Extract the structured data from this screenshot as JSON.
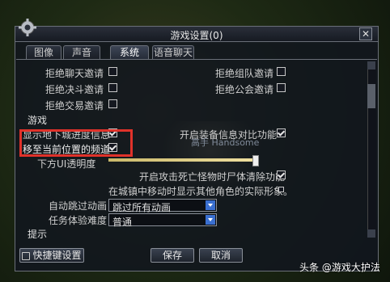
{
  "window": {
    "title": "游戏设置(0)"
  },
  "tabs": [
    {
      "label": "图像"
    },
    {
      "label": "声音"
    },
    {
      "label": "系统"
    },
    {
      "label": "语音聊天"
    }
  ],
  "privacy": {
    "chat_label": "拒绝聊天邀请",
    "party_label": "拒绝组队邀请",
    "duel_label": "拒绝决斗邀请",
    "guild_label": "拒绝公会邀请",
    "trade_label": "拒绝交易邀请"
  },
  "game": {
    "section_label": "游戏",
    "dungeon_progress_label": "显示地下城进度信息",
    "compare_label": "开启装备信息对比功能",
    "move_channel_label": "移至当前位置的频道",
    "minimap_label": "下方UI透明度",
    "corpse_label": "开启攻击死亡怪物时尸体清除功能",
    "town_label": "在城镇中移动时显示其他角色的实际形象。",
    "auto_skip_label": "自动跳过动画",
    "auto_skip_value": "跳过所有动画",
    "quest_label": "任务体验难度",
    "quest_value": "普通",
    "hint_section_label": "提示",
    "background_name": "高手 Handsome"
  },
  "buttons": {
    "shortcut": "快捷键设置",
    "save": "保存",
    "cancel": "取消"
  },
  "watermark": "头条 @游戏大护法",
  "slider": {
    "transparency_fraction": 0.98
  },
  "colors": {
    "highlight": "#e0322a",
    "accent": "#3a6fd0"
  }
}
